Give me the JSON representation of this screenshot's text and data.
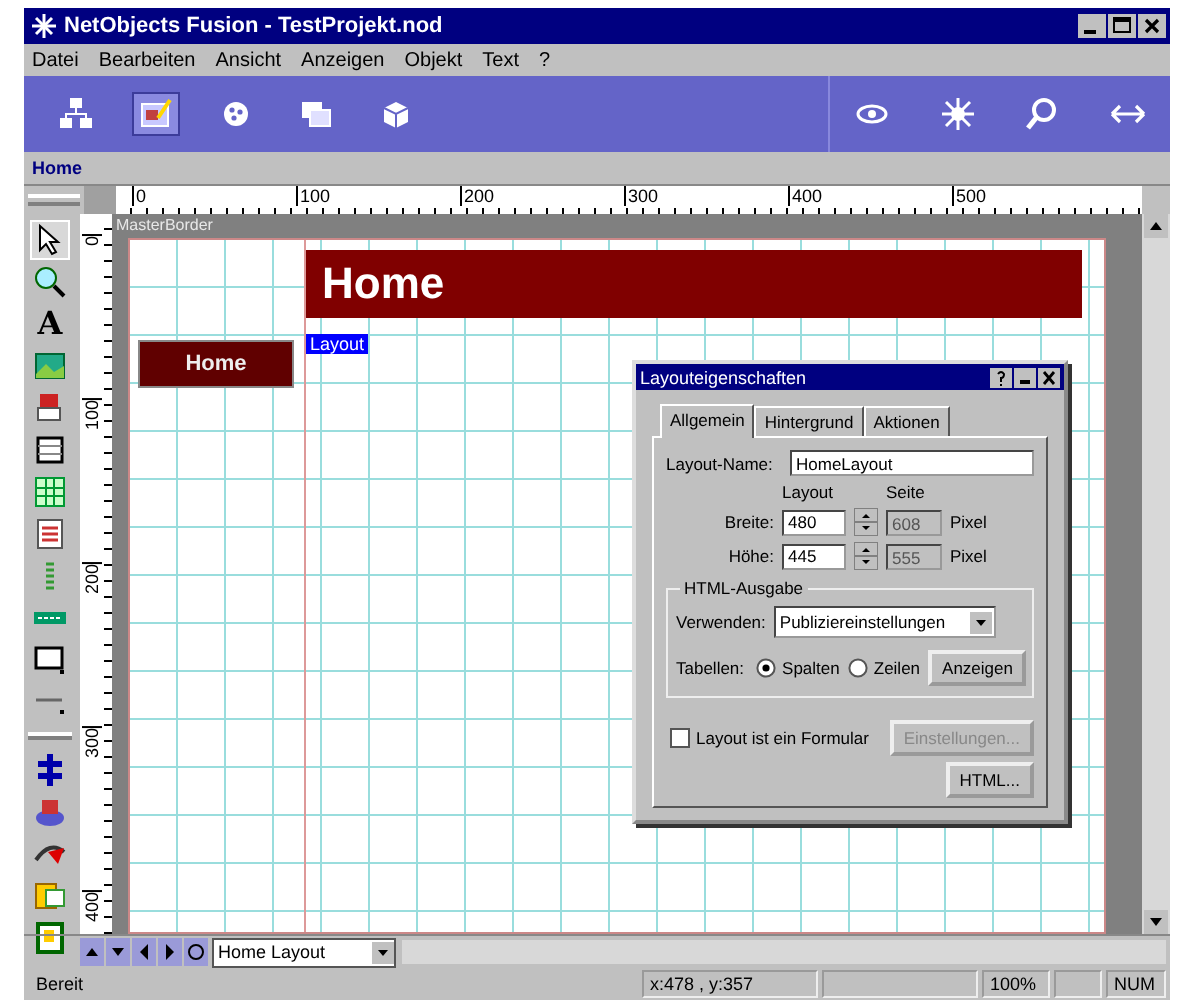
{
  "window": {
    "title": "NetObjects Fusion - TestProjekt.nod"
  },
  "menu": [
    "Datei",
    "Bearbeiten",
    "Ansicht",
    "Anzeigen",
    "Objekt",
    "Text",
    "?"
  ],
  "toolbar": {
    "buttons": [
      {
        "kind": "sitemap",
        "selected": false
      },
      {
        "kind": "page",
        "selected": true
      },
      {
        "kind": "style",
        "selected": false
      },
      {
        "kind": "assets",
        "selected": false
      },
      {
        "kind": "publish",
        "selected": false
      }
    ],
    "right_buttons": [
      {
        "kind": "eye"
      },
      {
        "kind": "sun"
      },
      {
        "kind": "search"
      },
      {
        "kind": "arrows"
      }
    ]
  },
  "breadcrumb": "Home",
  "ruler": {
    "h_labels": [
      "0",
      "100",
      "200",
      "300",
      "400",
      "500"
    ],
    "v_labels": [
      "0",
      "100",
      "200",
      "300",
      "400"
    ]
  },
  "palette": {
    "text_glyph": "A"
  },
  "canvas": {
    "master_border": "MasterBorder",
    "banner": "Home",
    "nav_button": "Home",
    "layout_label": "Layout"
  },
  "dialog": {
    "title": "Layouteigenschaften",
    "tabs": [
      {
        "label": "Allgemein",
        "selected": true
      },
      {
        "label": "Hintergrund",
        "selected": false
      },
      {
        "label": "Aktionen",
        "selected": false
      }
    ],
    "name_label": "Layout-Name:",
    "name_value": "HomeLayout",
    "col_layout": "Layout",
    "col_page": "Seite",
    "rows": [
      {
        "label": "Breite:",
        "layout": "480",
        "page": "608",
        "unit": "Pixel"
      },
      {
        "label": "Höhe:",
        "layout": "445",
        "page": "555",
        "unit": "Pixel"
      }
    ],
    "group": "HTML-Ausgabe",
    "use_label": "Verwenden:",
    "use_value": "Publiziereinstellungen",
    "tables_label": "Tabellen:",
    "radios": [
      {
        "label": "Spalten",
        "selected": true
      },
      {
        "label": "Zeilen",
        "selected": false
      }
    ],
    "show_button": "Anzeigen",
    "form_check": {
      "label": "Layout ist ein Formular",
      "checked": false
    },
    "settings_button": {
      "label": "Einstellungen...",
      "disabled": true
    },
    "html_button": "HTML..."
  },
  "nav": {
    "layout_select": "Home Layout"
  },
  "status_bar": {
    "message": "Bereit",
    "coords": "x:478 , y:357",
    "zoom": "100%",
    "mode": "NUM"
  }
}
